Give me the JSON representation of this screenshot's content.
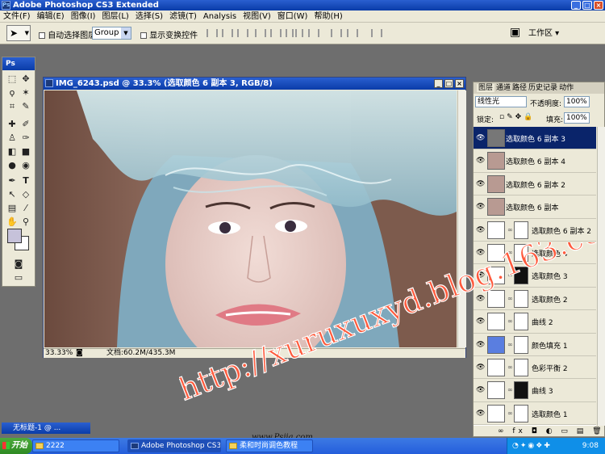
{
  "window": {
    "title": "Adobe Photoshop CS3 Extended"
  },
  "menu": [
    "文件(F)",
    "编辑(E)",
    "图像(I)",
    "图层(L)",
    "选择(S)",
    "滤镜(T)",
    "Analysis",
    "视图(V)",
    "窗口(W)",
    "帮助(H)"
  ],
  "options": {
    "auto_select_label": "自动选择图层",
    "group_value": "Group",
    "show_transform_label": "显示变换控件",
    "workspace_label": "工作区 ▾"
  },
  "toolbox": {
    "header": "Ps",
    "fg_color": "#c6c2da",
    "bg_color": "#ffffff"
  },
  "document": {
    "title": "IMG_6243.psd @ 33.3% (选取颜色 6 副本 3, RGB/8)",
    "zoom": "33.33%",
    "doc_info": "文档:60.2M/435.3M"
  },
  "layers_panel": {
    "tabs": [
      "图层",
      "通道",
      "路径",
      "历史记录",
      "动作"
    ],
    "blend_mode": "线性光",
    "opacity_label": "不透明度:",
    "opacity_value": "100%",
    "lock_label": "锁定:",
    "fill_label": "填充:",
    "fill_value": "100%",
    "layers": [
      {
        "name": "选取颜色 6 副本 3",
        "thumb": "gray",
        "selected": true
      },
      {
        "name": "选取颜色 6 副本 4",
        "thumb": "photo"
      },
      {
        "name": "选取颜色 6 副本 2",
        "thumb": "photo"
      },
      {
        "name": "选取颜色 6 副本",
        "thumb": "photo"
      },
      {
        "name": "选取颜色 6 副本 2",
        "thumb": "adj"
      },
      {
        "name": "选取颜色 4",
        "thumb": "adj"
      },
      {
        "name": "选取颜色 3",
        "thumb": "adj"
      },
      {
        "name": "选取颜色 2",
        "thumb": "adj"
      },
      {
        "name": "曲线 2",
        "thumb": "curve"
      },
      {
        "name": "颜色填充 1",
        "thumb": "blue"
      },
      {
        "name": "色彩平衡 2",
        "thumb": "adj"
      },
      {
        "name": "曲线 3",
        "thumb": "curve"
      },
      {
        "name": "选取颜色 1",
        "thumb": "adj"
      }
    ],
    "footer_icons": "∞ fx ◘ ◐ ▭ ▤ 🗑"
  },
  "minimized_doc": "无标题-1 @ ...",
  "watermark": {
    "url_text": "http://xuruxuxyd.blog.163.com/",
    "site_text": "www.Psjia.com"
  },
  "taskbar": {
    "start_label": "开始",
    "tasks": [
      "2222",
      "Adobe Photoshop CS3 E...",
      "柔和时尚调色教程"
    ],
    "clock": "9:08"
  }
}
